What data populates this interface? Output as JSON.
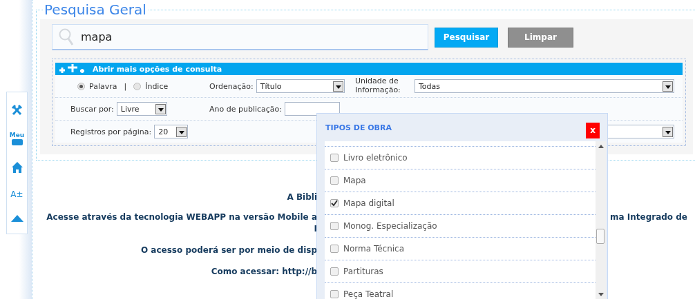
{
  "toolbar": {
    "menu_label": "Meu",
    "font_label": "A±"
  },
  "title": "Pesquisa Geral",
  "search": {
    "value": "mapa"
  },
  "buttons": [
    {
      "label": "Pesquisar",
      "kind": "primary"
    },
    {
      "label": "Limpar",
      "kind": "secondary"
    }
  ],
  "options": {
    "header": "Abrir mais opções de consulta",
    "mode": [
      {
        "label": "Palavra",
        "selected": true
      },
      {
        "label": "Índice",
        "selected": false
      }
    ],
    "separator": "|",
    "ordering": {
      "label": "Ordenação:",
      "value": "Título"
    },
    "unit": {
      "label": "Unidade de Informação:",
      "value": "Todas"
    },
    "search_by": {
      "label": "Buscar por:",
      "value": "Livre"
    },
    "year": {
      "label": "Ano de publicação:"
    },
    "per_page": {
      "label": "Registros por página:",
      "value": "20"
    }
  },
  "info_lines": [
    {
      "left": "A Bibli"
    },
    {
      "left": "Acesse através da tecnologia WEBAPP na versão Mobile a",
      "right": "ma Integrado de"
    },
    {
      "left": "I"
    },
    {
      "left": "O acesso poderá ser por meio de disp"
    },
    {
      "left": "Como acessar: http://b"
    }
  ],
  "dialog": {
    "title": "TIPOS DE OBRA",
    "close": "x",
    "items": [
      {
        "label": "Livro eletrônico",
        "checked": false
      },
      {
        "label": "Mapa",
        "checked": false
      },
      {
        "label": "Mapa digital",
        "checked": true
      },
      {
        "label": "Monog. Especialização",
        "checked": false
      },
      {
        "label": "Norma Técnica",
        "checked": false
      },
      {
        "label": "Partituras",
        "checked": false
      },
      {
        "label": "Peça Teatral",
        "checked": false
      }
    ]
  }
}
